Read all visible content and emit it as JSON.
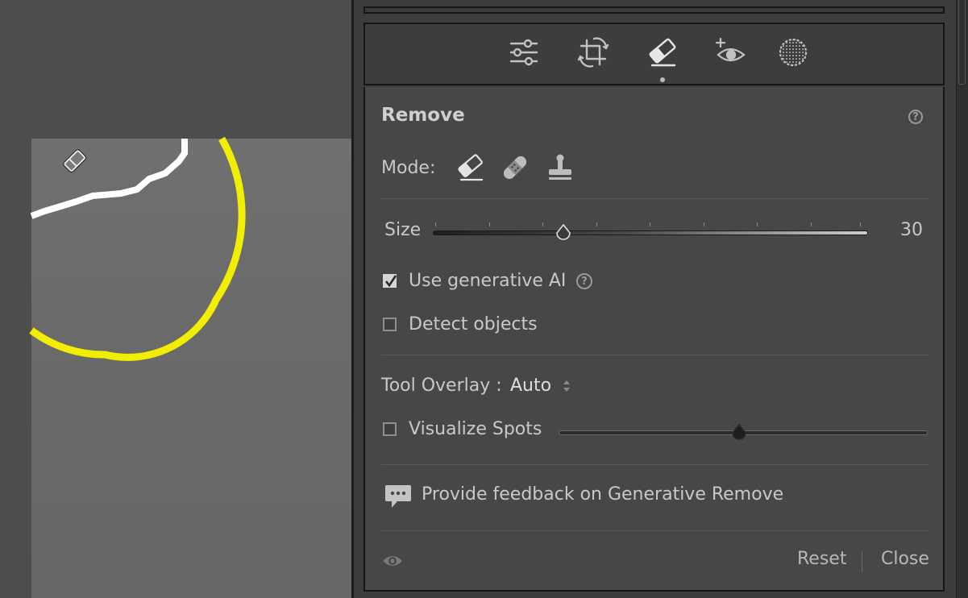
{
  "panel": {
    "title": "Remove",
    "help_icon": "question-circle-icon",
    "tools": [
      "edit-sliders-icon",
      "crop-rotate-icon",
      "eraser-remove-icon",
      "red-eye-icon",
      "masking-icon"
    ],
    "mode": {
      "label": "Mode:",
      "options": [
        "eraser-remove-icon",
        "healing-bandage-icon",
        "clone-stamp-icon"
      ]
    },
    "size": {
      "label": "Size",
      "value": "30",
      "fraction": 0.3
    },
    "use_generative_ai": {
      "label": "Use generative AI",
      "checked": true
    },
    "detect_objects": {
      "label": "Detect objects",
      "checked": false
    },
    "tool_overlay": {
      "label": "Tool Overlay :",
      "value": "Auto"
    },
    "visualize_spots": {
      "label": "Visualize Spots",
      "checked": false,
      "fraction": 0.49
    },
    "feedback": {
      "label": "Provide feedback on Generative Remove",
      "icon": "speech-bubble-icon"
    },
    "footer": {
      "visibility_icon": "eye-icon",
      "reset": "Reset",
      "close": "Close"
    }
  },
  "colors": {
    "brush_outline": "#f2ee00",
    "selection_stroke": "#ffffff",
    "panel_bg": "#474747"
  }
}
